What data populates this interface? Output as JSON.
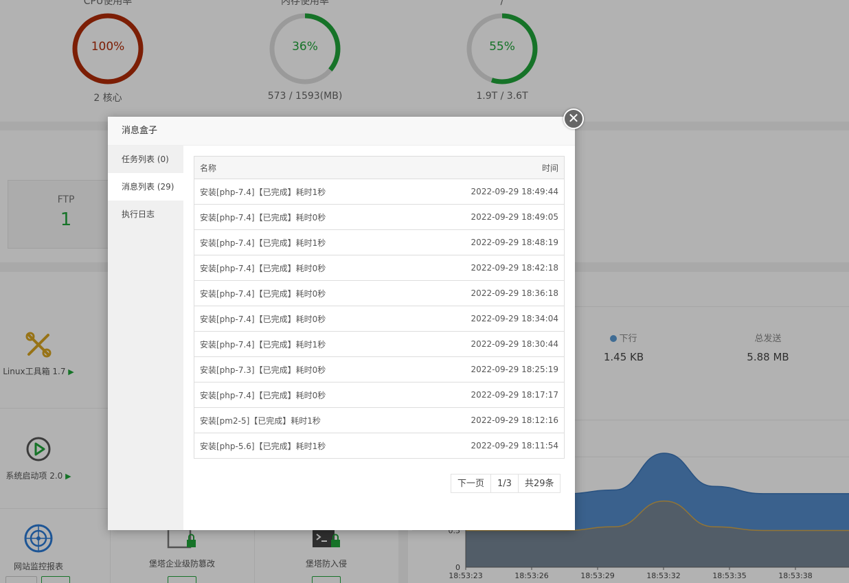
{
  "gauges": [
    {
      "title": "CPU使用率",
      "percent": "100%",
      "value": 100,
      "sub": "2 核心",
      "color": "#b22c08"
    },
    {
      "title": "内存使用率",
      "percent": "36%",
      "value": 36,
      "sub": "573 / 1593(MB)",
      "color": "#20a53a"
    },
    {
      "title": "/",
      "percent": "55%",
      "value": 55,
      "sub": "1.9T / 3.6T",
      "color": "#20a53a"
    }
  ],
  "stats": {
    "ftp_label": "FTP",
    "ftp_value": "1"
  },
  "software": {
    "linux_tools": "Linux工具箱 1.7",
    "startup": "系统启动项 2.0",
    "site_monitor": "网站监控报表",
    "tamper": "堡塔企业级防篡改",
    "intrusion": "堡塔防入侵",
    "play_symbol": "▶"
  },
  "network": {
    "down_label": "下行",
    "down_value": "1.45 KB",
    "total_send_label": "总发送",
    "total_send_value": "5.88 MB"
  },
  "chart_data": {
    "type": "area",
    "x": [
      "18:53:23",
      "18:53:26",
      "18:53:29",
      "18:53:32",
      "18:53:35",
      "18:53:38"
    ],
    "yticks": [
      "0",
      "0.5"
    ],
    "series": [
      {
        "values": [
          1.0,
          1.0,
          1.0,
          1.05,
          1.55,
          1.1,
          1.0,
          1.0,
          1.0
        ],
        "color": "#4a86c8"
      },
      {
        "values": [
          0.5,
          0.5,
          0.5,
          0.55,
          0.9,
          0.55,
          0.5,
          0.5,
          0.5
        ],
        "color": "#7a8590"
      }
    ],
    "ylim": [
      0,
      2.0
    ]
  },
  "modal": {
    "title": "消息盒子",
    "close_symbol": "✕",
    "tabs": [
      {
        "label": "任务列表 (0)",
        "active": false
      },
      {
        "label": "消息列表 (29)",
        "active": true
      },
      {
        "label": "执行日志",
        "active": false
      }
    ],
    "table": {
      "headers": {
        "name": "名称",
        "time": "时间"
      },
      "rows": [
        {
          "name": "安装[php-7.4]【已完成】耗时1秒",
          "time": "2022-09-29 18:49:44"
        },
        {
          "name": "安装[php-7.4]【已完成】耗时0秒",
          "time": "2022-09-29 18:49:05"
        },
        {
          "name": "安装[php-7.4]【已完成】耗时1秒",
          "time": "2022-09-29 18:48:19"
        },
        {
          "name": "安装[php-7.4]【已完成】耗时0秒",
          "time": "2022-09-29 18:42:18"
        },
        {
          "name": "安装[php-7.4]【已完成】耗时0秒",
          "time": "2022-09-29 18:36:18"
        },
        {
          "name": "安装[php-7.4]【已完成】耗时0秒",
          "time": "2022-09-29 18:34:04"
        },
        {
          "name": "安装[php-7.4]【已完成】耗时1秒",
          "time": "2022-09-29 18:30:44"
        },
        {
          "name": "安装[php-7.3]【已完成】耗时0秒",
          "time": "2022-09-29 18:25:19"
        },
        {
          "name": "安装[php-7.4]【已完成】耗时0秒",
          "time": "2022-09-29 18:17:17"
        },
        {
          "name": "安装[pm2-5]【已完成】耗时1秒",
          "time": "2022-09-29 18:12:16"
        },
        {
          "name": "安装[php-5.6]【已完成】耗时1秒",
          "time": "2022-09-29 18:11:54"
        }
      ]
    },
    "pager": {
      "next": "下一页",
      "page": "1/3",
      "total": "共29条"
    }
  }
}
